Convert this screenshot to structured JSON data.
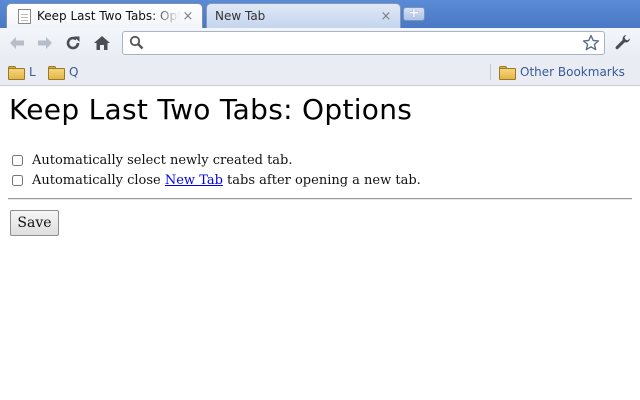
{
  "tabs": [
    {
      "title": "Keep Last Two Tabs: Options",
      "close": "×"
    },
    {
      "title": "New Tab",
      "close": "×"
    }
  ],
  "new_tab_button": "+",
  "toolbar": {
    "back": "back-arrow-icon",
    "forward": "forward-arrow-icon",
    "reload": "reload-icon",
    "home": "home-icon",
    "search": "search-icon",
    "star": "star-icon",
    "wrench": "wrench-icon",
    "omnibox_value": ""
  },
  "bookmarks": {
    "items": [
      {
        "label": "L",
        "icon": "folder-icon"
      },
      {
        "label": "Q",
        "icon": "folder-icon"
      }
    ],
    "other": {
      "label": "Other Bookmarks",
      "icon": "folder-icon"
    }
  },
  "page": {
    "title": "Keep Last Two Tabs: Options",
    "options": [
      {
        "text": "Automatically select newly created tab.",
        "checked": false
      },
      {
        "text_before": "Automatically close ",
        "link": "New Tab",
        "text_after": " tabs after opening a new tab.",
        "checked": false
      }
    ],
    "save_label": "Save"
  },
  "colors": {
    "tabstrip": "#4a78c4",
    "link": "#0000ee",
    "bookmark_text": "#3b5998"
  }
}
